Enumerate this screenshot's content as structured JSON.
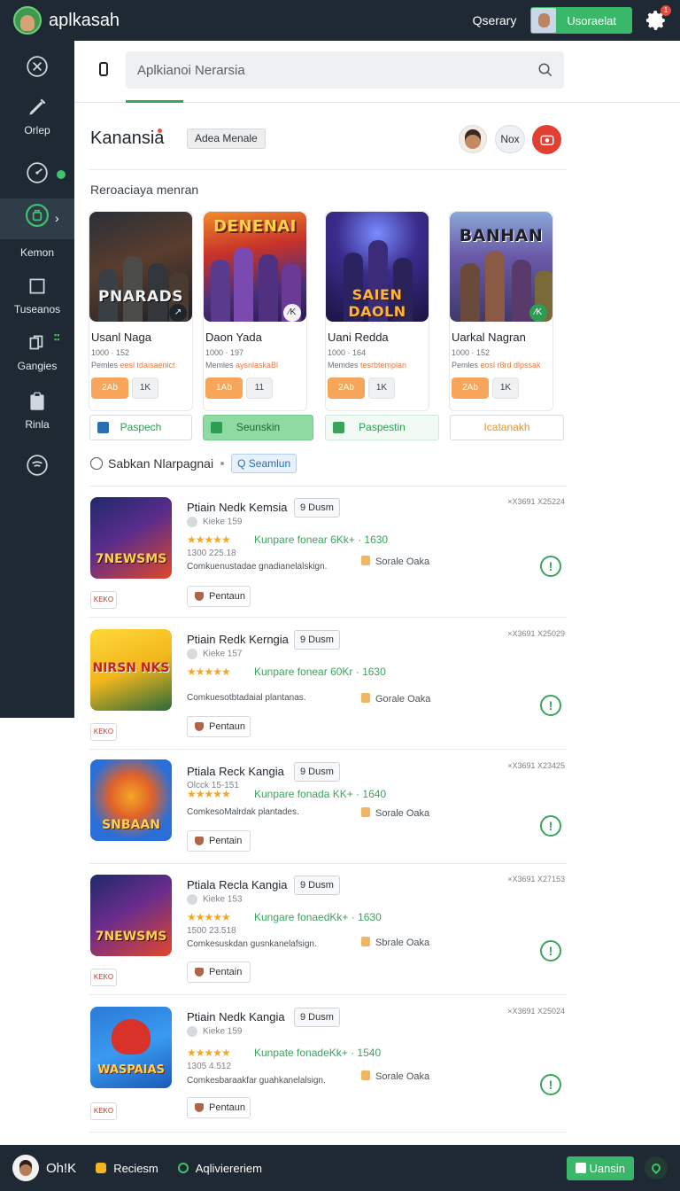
{
  "header": {
    "app_name": "aplkasah",
    "query_label": "Qserary",
    "user_button": "Usoraelat",
    "notification_count": "1"
  },
  "sidebar": {
    "items": [
      {
        "label": "",
        "icon": "tools-icon"
      },
      {
        "label": "Orlep",
        "icon": "pen-icon"
      },
      {
        "label": "",
        "icon": "gauge-icon"
      },
      {
        "label": "Kemon",
        "icon": "bag-icon",
        "active": true
      },
      {
        "label": "Tuseanos",
        "icon": "square-icon"
      },
      {
        "label": "Gangies",
        "icon": "copy-icon"
      },
      {
        "label": "Rinla",
        "icon": "clipboard-icon"
      },
      {
        "label": "",
        "icon": "signal-icon"
      }
    ]
  },
  "search": {
    "placeholder": "Aplkianoi Nerarsia"
  },
  "section": {
    "title": "Kanansia",
    "chip": "Adea Menale",
    "nox_label": "Nox",
    "subtitle": "Reroaciaya menran"
  },
  "cards": [
    {
      "art_title": "PNARADS",
      "name": "Usanl Naga",
      "meta": "1000 · 152",
      "desc_a": "Pemles ",
      "desc_b": "eesl tdaisaenict",
      "pill_a": "2Ab",
      "pill_b": "1K",
      "badge": "↗"
    },
    {
      "art_title": "DENENAI",
      "name": "Daon Yada",
      "meta": "1000 · 197",
      "desc_a": "Memles ",
      "desc_b": "aysnlaskaBl",
      "pill_a": "1Ab",
      "pill_b": "11",
      "badge": "⁄K"
    },
    {
      "art_title": "SAIEN DAOLN",
      "name": "Uani Redda",
      "meta": "1000 · 164",
      "desc_a": "Memdes ",
      "desc_b": "tesrbtemplan",
      "pill_a": "2Ab",
      "pill_b": "1K",
      "badge": ""
    },
    {
      "art_title": "BANHAN",
      "name": "Uarkal Nagran",
      "meta": "1000 · 152",
      "desc_a": "Pemles ",
      "desc_b": "eosl r8rd dlpssak",
      "pill_a": "2Ab",
      "pill_b": "1K",
      "badge": "⁄K"
    }
  ],
  "actions": [
    {
      "label": "Paspech"
    },
    {
      "label": "Seunskin"
    },
    {
      "label": "Paspestin"
    },
    {
      "label": "Icatanakh"
    }
  ],
  "filter": {
    "label": "Sabkan Nlarpagnai",
    "chip": "Q Seamlun"
  },
  "list": [
    {
      "title": "Ptiain Nedk  Kemsia",
      "chip": "9 Dusm",
      "sub": "Kieke 159",
      "stars": "★★★★★",
      "rate": "Kunpare fonear 6Kk+ · 1630",
      "size": "1300 225.18",
      "desc": "Comkuenustadae gnadianelalskign.",
      "store": "Sorale Oaka",
      "code": "×X3691 X25224",
      "tag": "KEKO",
      "art_title": "7NEWSMS",
      "btn": "Pentaun"
    },
    {
      "title": "Ptiain Redk  Kerngia",
      "chip": "9 Dusm",
      "sub": "Kieke 157",
      "stars": "★★★★★",
      "rate": "Kunpare fonear 60Kr · 1630",
      "size": "",
      "desc": "Comkuesotbtadaial plantanas.",
      "store": "Gorale Oaka",
      "code": "×X3691 X25029",
      "tag": "KEKO",
      "art_title": "NIRSN NKS",
      "btn": "Pentaun"
    },
    {
      "title": "Ptiala Reck  Kangia",
      "chip": "9 Dusm",
      "sub": "Olcck 15-151",
      "stars": "★★★★★",
      "rate": "Kunpare fonada KK+ · 1640",
      "size": "",
      "desc": "ComkesoMalrdak plantades.",
      "store": "Sorale Oaka",
      "code": "×X3691 X23425",
      "tag": "",
      "art_title": "SNBAAN",
      "btn": "Pentain"
    },
    {
      "title": "Ptiala Recla  Kangia",
      "chip": "9 Dusm",
      "sub": "Kieke 153",
      "stars": "★★★★★",
      "rate": "Kungare fonaedKk+ · 1630",
      "size": "1500 23.518",
      "desc": "Comkesuskdan gusnkanelafsign.",
      "store": "Sbrale Oaka",
      "code": "×X3691 X27153",
      "tag": "KEKO",
      "art_title": "7NEWSMS",
      "btn": "Pentain"
    },
    {
      "title": "Ptiain Nedk  Kangia",
      "chip": "9 Dusm",
      "sub": "Kieke 159",
      "stars": "★★★★★",
      "rate": "Kunpate fonadeKk+ · 1540",
      "size": "1305 4.512",
      "desc": "Comkesbaraakfar guahkanelalsign.",
      "store": "Sorale Oaka",
      "code": "×X3691 X25024",
      "tag": "KEKO",
      "art_title": "WASPAIAS",
      "btn": "Pentaun"
    }
  ],
  "bottom": {
    "name": "Oh!K",
    "item1": "Reciesm",
    "item2": "Aqliviereriem",
    "button": "Uansin"
  },
  "colors": {
    "dark": "#1f2933",
    "accent": "#39b86a",
    "orange": "#f6a55a",
    "alert": "#e23f33"
  }
}
